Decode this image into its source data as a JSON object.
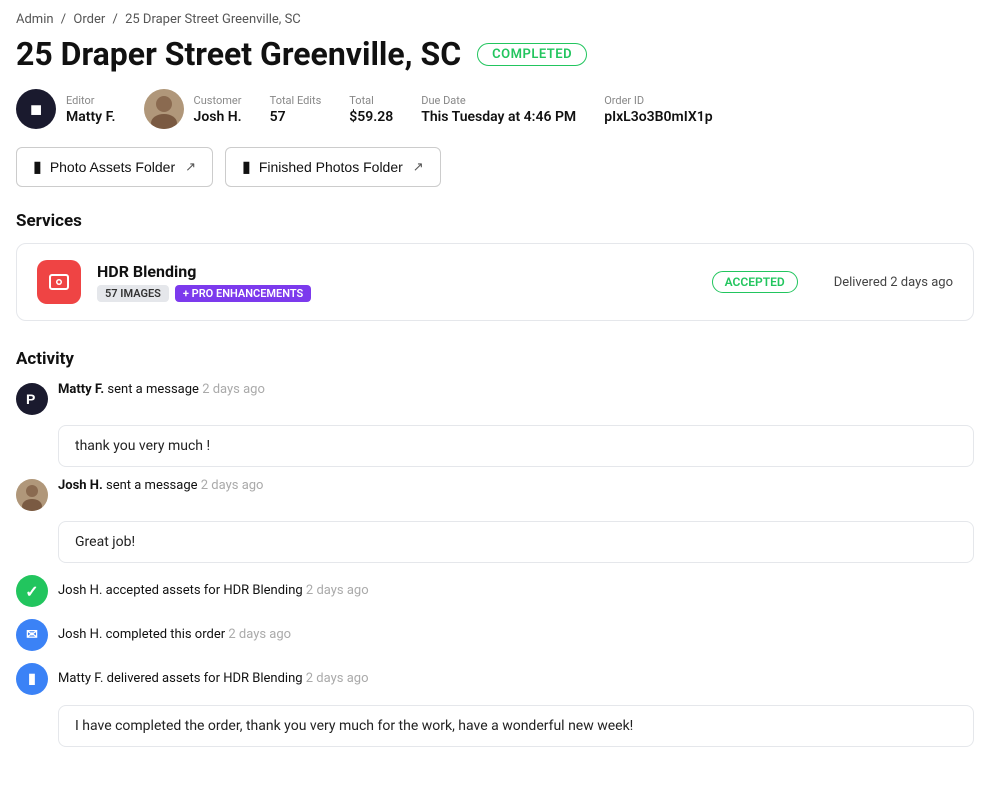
{
  "breadcrumb": {
    "items": [
      "Admin",
      "Order",
      "25 Draper Street  Greenville, SC"
    ]
  },
  "header": {
    "title": "25 Draper Street  Greenville, SC",
    "status": "COMPLETED"
  },
  "meta": {
    "editor_label": "Editor",
    "editor_name": "Matty F.",
    "customer_label": "Customer",
    "customer_name": "Josh H.",
    "total_edits_label": "Total Edits",
    "total_edits_value": "57",
    "total_label": "Total",
    "total_value": "$59.28",
    "due_date_label": "Due Date",
    "due_date_value": "This Tuesday at 4:46 PM",
    "order_id_label": "Order ID",
    "order_id_value": "pIxL3o3B0mIX1p"
  },
  "folders": {
    "photo_assets_label": "Photo Assets Folder",
    "finished_photos_label": "Finished Photos Folder"
  },
  "services": {
    "section_title": "Services",
    "service_name": "HDR Blending",
    "tag_images": "57 IMAGES",
    "tag_pro": "+ PRO ENHANCEMENTS",
    "status": "ACCEPTED",
    "delivered": "Delivered 2 days ago"
  },
  "activity": {
    "section_title": "Activity",
    "items": [
      {
        "type": "message",
        "sender": "Matty F.",
        "action": " sent a message",
        "timestamp": "2 days ago",
        "message": "thank you very much !"
      },
      {
        "type": "message",
        "sender": "Josh H.",
        "action": "sent a message",
        "timestamp": "2 days ago",
        "message": "Great job!"
      },
      {
        "type": "accepted",
        "sender": "Josh H.",
        "action": " accepted assets for HDR Blending",
        "timestamp": "2 days ago"
      },
      {
        "type": "completed",
        "sender": "Josh H.",
        "action": "completed this order",
        "timestamp": "2 days ago"
      },
      {
        "type": "delivered",
        "sender": "Matty F.",
        "action": "delivered assets for HDR Blending",
        "timestamp": "2 days ago",
        "message": "I have completed the order, thank you very much for the work, have a wonderful new week!"
      }
    ]
  }
}
